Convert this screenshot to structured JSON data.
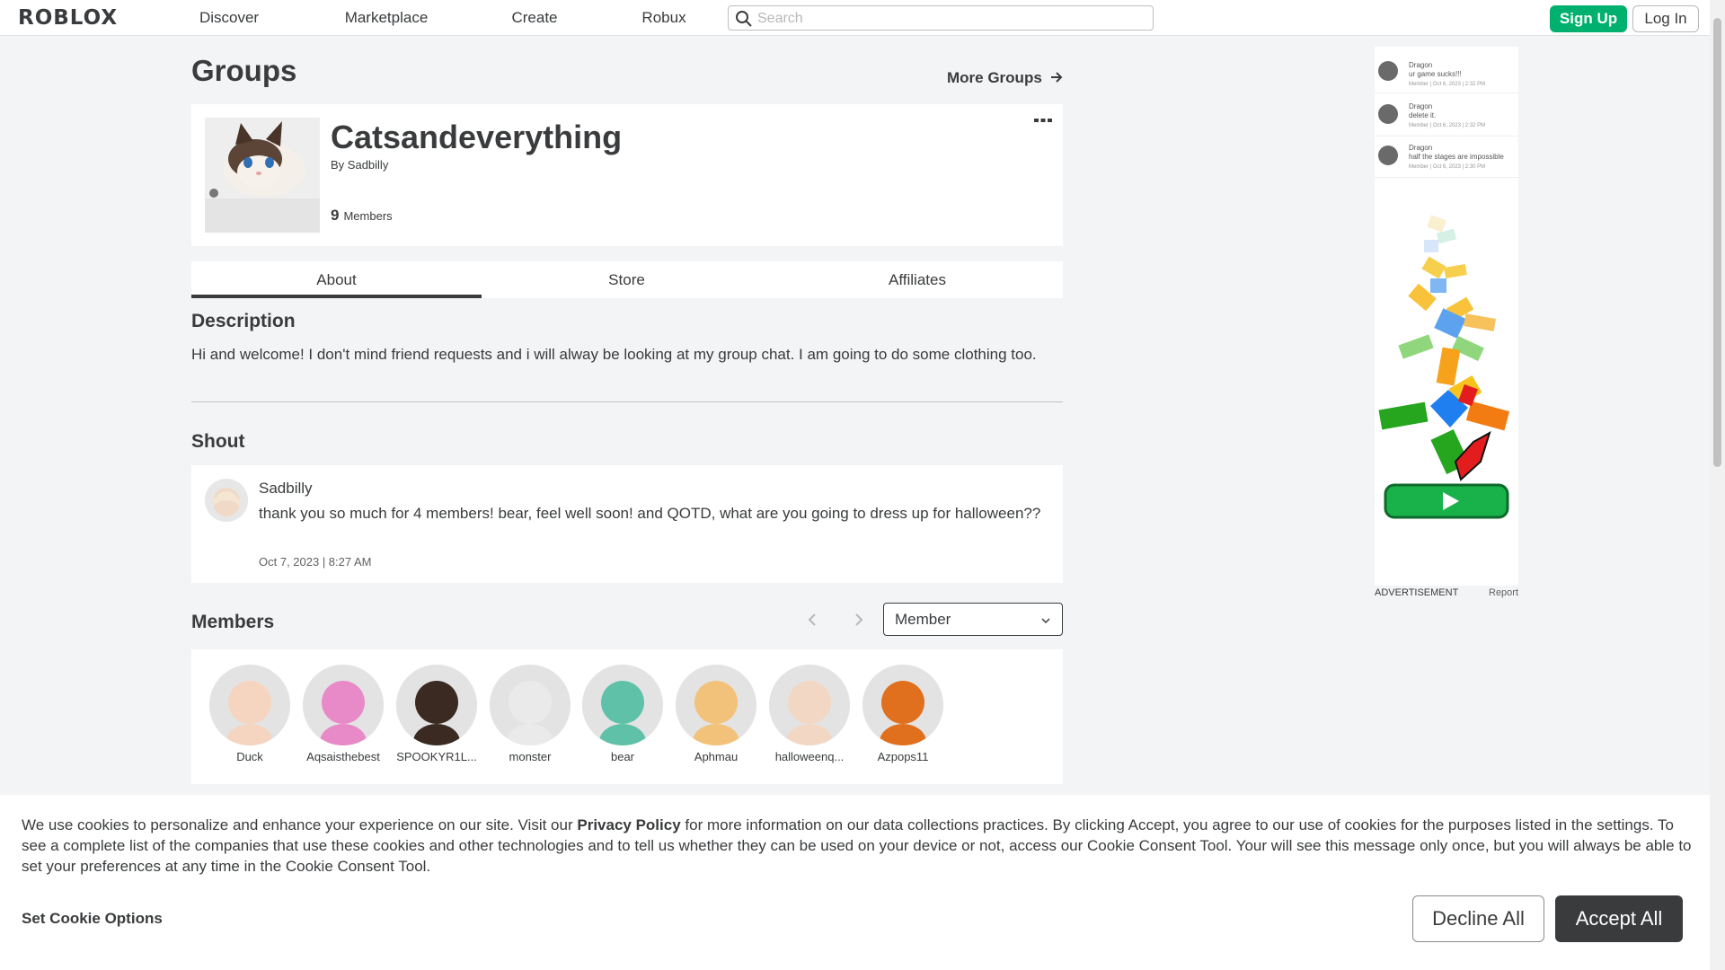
{
  "nav": {
    "logo": "ROBLOX",
    "links": [
      "Discover",
      "Marketplace",
      "Create",
      "Robux"
    ],
    "search_placeholder": "Search",
    "signup": "Sign Up",
    "login": "Log In"
  },
  "header": {
    "title": "Groups",
    "more_groups": "More Groups"
  },
  "group": {
    "name": "Catsandeverything",
    "owner_prefix": "By",
    "owner": "Sadbilly",
    "member_count": "9",
    "members_label": "Members"
  },
  "tabs": [
    "About",
    "Store",
    "Affiliates"
  ],
  "description": {
    "title": "Description",
    "text": "Hi and welcome! I don't mind friend requests and i will alway be looking at my group chat. I am going to do some clothing too."
  },
  "shout": {
    "title": "Shout",
    "author": "Sadbilly",
    "body": "thank you so much for 4 members! bear, feel well soon! and QOTD, what are you going to dress up for halloween??",
    "date": "Oct 7, 2023 | 8:27 AM"
  },
  "members": {
    "title": "Members",
    "role_selected": "Member",
    "list": [
      {
        "name": "Duck",
        "color": "#f5d5c0"
      },
      {
        "name": "Aqsaisthebest",
        "color": "#e88ac8"
      },
      {
        "name": "SPOOKYR1L...",
        "color": "#3a2a22"
      },
      {
        "name": "monster",
        "color": "#eaeaea"
      },
      {
        "name": "bear",
        "color": "#5fc2a8"
      },
      {
        "name": "Aphmau",
        "color": "#f3c27a"
      },
      {
        "name": "halloweenq...",
        "color": "#f2d8c4"
      },
      {
        "name": "Azpops11",
        "color": "#e0701e"
      }
    ]
  },
  "ad": {
    "label": "ADVERTISEMENT",
    "report": "Report",
    "comments": [
      {
        "user": "Dragon",
        "text": "ur game sucks!!!",
        "meta": "Member | Oct 6, 2023 | 2:32 PM"
      },
      {
        "user": "Dragon",
        "text": "delete it.",
        "meta": "Member | Oct 6, 2023 | 2:32 PM"
      },
      {
        "user": "Dragon",
        "text": "half the stages are impossible",
        "meta": "Member | Oct 6, 2023 | 2:30 PM"
      }
    ]
  },
  "cookie": {
    "text_before": "We use cookies to personalize and enhance your experience on our site. Visit our ",
    "link": "Privacy Policy",
    "text_after": " for more information on our data collections practices. By clicking Accept, you agree to our use of cookies for the purposes listed in the settings. To see a complete list of the companies that use these cookies and other technologies and to tell us whether they can be used on your device or not, access our Cookie Consent Tool. Your will see this message only once, but you will always be able to set your preferences at any time in the Cookie Consent Tool.",
    "options": "Set Cookie Options",
    "decline": "Decline All",
    "accept": "Accept All"
  },
  "colors": {
    "accent_green": "#00b06f",
    "text": "#393b3d",
    "background": "#f2f4f5"
  }
}
